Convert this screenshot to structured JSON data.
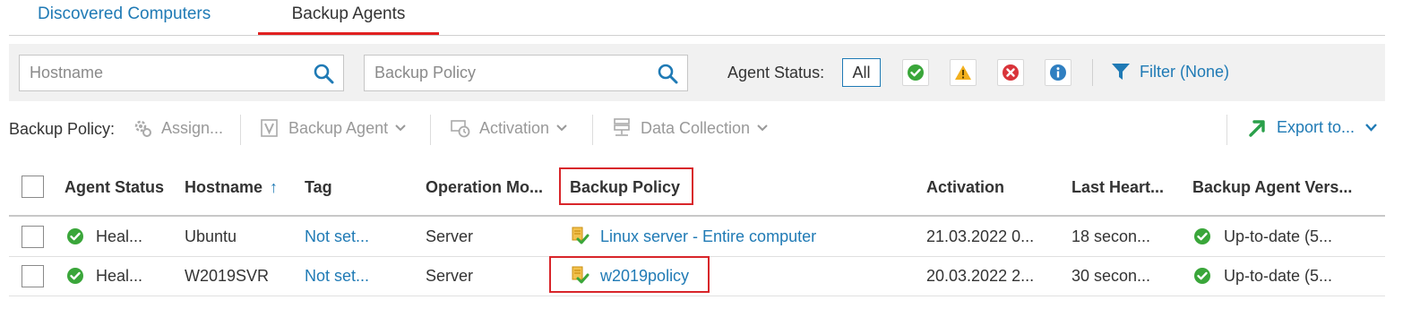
{
  "tabs": [
    {
      "label": "Discovered Computers",
      "active": false
    },
    {
      "label": "Backup Agents",
      "active": true
    }
  ],
  "filters": {
    "hostname_placeholder": "Hostname",
    "policy_placeholder": "Backup Policy",
    "agent_status_label": "Agent Status:",
    "all_label": "All",
    "status_buttons": [
      "healthy-icon",
      "warning-icon",
      "error-icon",
      "info-icon"
    ],
    "filter_label": "Filter (None)"
  },
  "toolbar": {
    "backup_policy_label": "Backup Policy:",
    "assign_label": "Assign...",
    "backup_agent_label": "Backup Agent",
    "activation_label": "Activation",
    "data_collection_label": "Data Collection",
    "export_label": "Export to..."
  },
  "table": {
    "columns": [
      "Agent Status",
      "Hostname",
      "Tag",
      "Operation Mo...",
      "Backup Policy",
      "Activation",
      "Last Heart...",
      "Backup Agent Vers..."
    ],
    "sort_column": "Hostname",
    "sort_direction": "ascending",
    "rows": [
      {
        "status": "Heal...",
        "hostname": "Ubuntu",
        "tag": "Not set...",
        "mode": "Server",
        "policy": "Linux server - Entire computer",
        "activation": "21.03.2022 0...",
        "heartbeat": "18 secon...",
        "version": "Up-to-date (5..."
      },
      {
        "status": "Heal...",
        "hostname": "W2019SVR",
        "tag": "Not set...",
        "mode": "Server",
        "policy": "w2019policy",
        "activation": "20.03.2022 2...",
        "heartbeat": "30 secon...",
        "version": "Up-to-date (5..."
      }
    ]
  },
  "colors": {
    "accent": "#1f7ab5",
    "highlight": "#d8252a",
    "healthy": "#3aa63a",
    "warning": "#f2b01e",
    "error": "#d9343a"
  }
}
